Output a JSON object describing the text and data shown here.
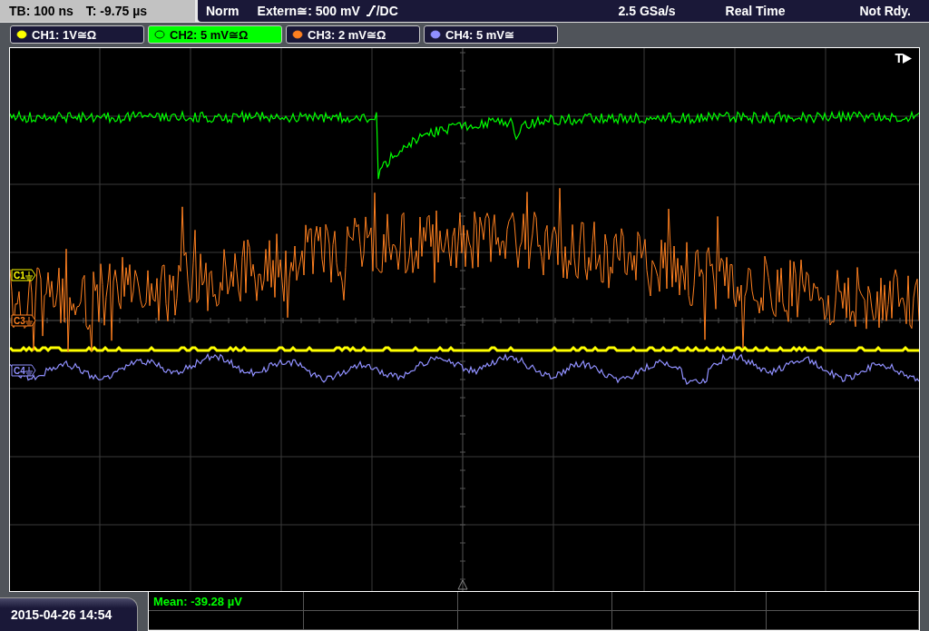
{
  "status_bar": {
    "timebase": "TB: 100 ns",
    "trigger_time": "T: -9.75 µs",
    "trigger_mode": "Norm",
    "trigger_source": "Extern≅: 500 mV",
    "trigger_coupling": "/DC",
    "sample_rate": "2.5 GSa/s",
    "acquisition": "Real Time",
    "status": "Not Rdy."
  },
  "channels": [
    {
      "label": "CH1: 1V≅Ω",
      "color": "#ffff00",
      "selected": false
    },
    {
      "label": "CH2: 5 mV≅Ω",
      "color": "#00ff00",
      "selected": true
    },
    {
      "label": "CH3: 2 mV≅Ω",
      "color": "#ff8020",
      "selected": false
    },
    {
      "label": "CH4: 5 mV≅",
      "color": "#9090ff",
      "selected": false
    }
  ],
  "plot": {
    "trigger_label": "T",
    "markers": [
      {
        "label": "C1",
        "color": "#ffff00"
      },
      {
        "label": "C3",
        "color": "#ff8020"
      },
      {
        "label": "C4",
        "color": "#9090ff"
      }
    ]
  },
  "measurements": [
    {
      "text": "Mean: -39.28 µV"
    }
  ],
  "date_time": "2015-04-26 14:54"
}
